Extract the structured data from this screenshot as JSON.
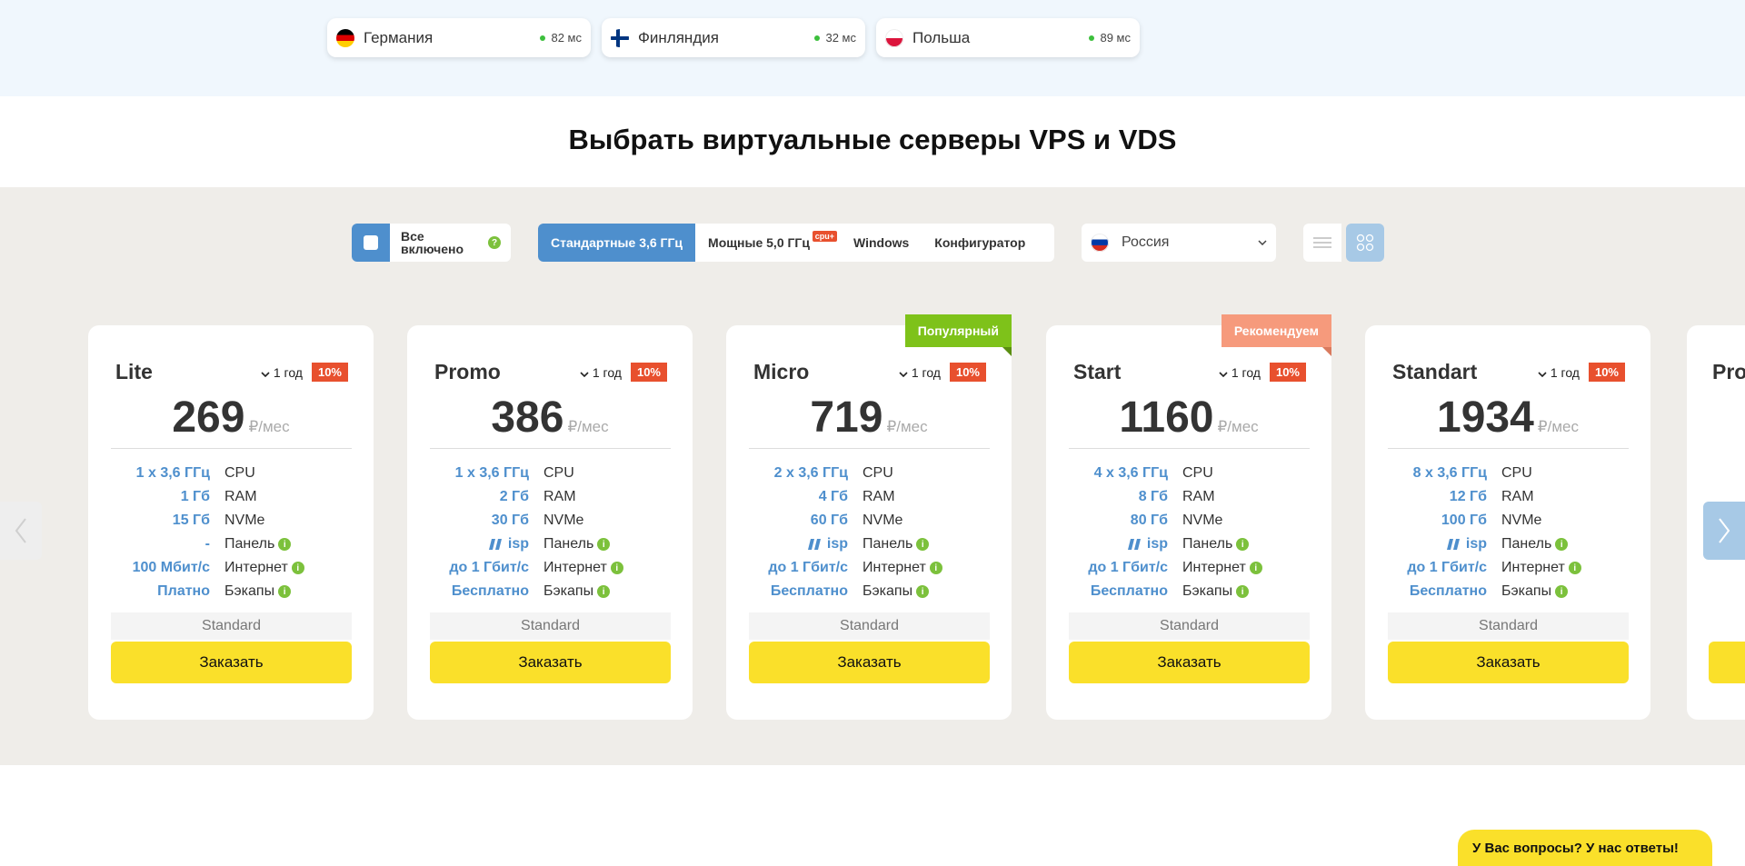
{
  "locations": [
    {
      "name": "Германия",
      "ping": "82 мс",
      "flag": "germany-flag"
    },
    {
      "name": "Финляндия",
      "ping": "32 мс",
      "flag": "finland-flag"
    },
    {
      "name": "Польша",
      "ping": "89 мс",
      "flag": "poland-flag"
    }
  ],
  "page_title": "Выбрать виртуальные серверы VPS и VDS",
  "filters": {
    "all_included": "Все включено",
    "help_mark": "?",
    "tabs": [
      "Стандартные 3,6 ГГц",
      "Мощные 5,0 ГГц",
      "Windows",
      "Конфигуратор"
    ],
    "cpu_badge": "cpu+",
    "region": "Россия"
  },
  "common": {
    "currency": "₽/мес",
    "period": "1 год",
    "discount": "10%",
    "spec_labels": [
      "CPU",
      "RAM",
      "NVMe",
      "Панель",
      "Интернет",
      "Бэкапы"
    ],
    "tier": "Standard",
    "order_label": "Заказать",
    "info_mark": "i"
  },
  "plans": [
    {
      "name": "Lite",
      "price": "269",
      "cpu": "1 x 3,6 ГГц",
      "ram": "1 Гб",
      "nvme": "15 Гб",
      "panel": "-",
      "internet": "100 Мбит/с",
      "backup": "Платно",
      "ribbon": ""
    },
    {
      "name": "Promo",
      "price": "386",
      "cpu": "1 x 3,6 ГГц",
      "ram": "2 Гб",
      "nvme": "30 Гб",
      "panel": "isp",
      "internet": "до 1 Гбит/с",
      "backup": "Бесплатно",
      "ribbon": ""
    },
    {
      "name": "Micro",
      "price": "719",
      "cpu": "2 x 3,6 ГГц",
      "ram": "4 Гб",
      "nvme": "60 Гб",
      "panel": "isp",
      "internet": "до 1 Гбит/с",
      "backup": "Бесплатно",
      "ribbon": "Популярный"
    },
    {
      "name": "Start",
      "price": "1160",
      "cpu": "4 x 3,6 ГГц",
      "ram": "8 Гб",
      "nvme": "80 Гб",
      "panel": "isp",
      "internet": "до 1 Гбит/с",
      "backup": "Бесплатно",
      "ribbon": "Рекомендуем"
    },
    {
      "name": "Standart",
      "price": "1934",
      "cpu": "8 x 3,6 ГГц",
      "ram": "12 Гб",
      "nvme": "100 Гб",
      "panel": "isp",
      "internet": "до 1 Гбит/с",
      "backup": "Бесплатно",
      "ribbon": ""
    }
  ],
  "next_plan_partial": "Pro",
  "chat_label": "У Вас вопросы? У нас ответы!",
  "colors": {
    "accent": "#4e8fcd",
    "order": "#fae02a",
    "discount": "#e8502e",
    "info": "#7cc13c"
  }
}
